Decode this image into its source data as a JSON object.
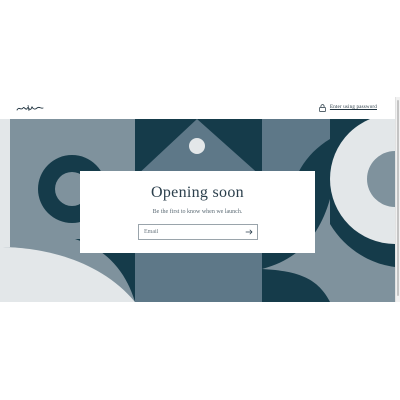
{
  "header": {
    "logo_name": "brand-logo",
    "password_link_label": "Enter using password",
    "password_icon": "lock-icon"
  },
  "hero": {
    "title": "Opening soon",
    "subtitle": "Be the first to know when we launch.",
    "email_placeholder": "Email",
    "submit_icon": "arrow-right-icon"
  },
  "colors": {
    "dark_teal": "#153b4a",
    "slate": "#5e7888",
    "gray_blue": "#7f929d",
    "light_gray": "#e3e7e9",
    "text": "#2b3f4c"
  }
}
